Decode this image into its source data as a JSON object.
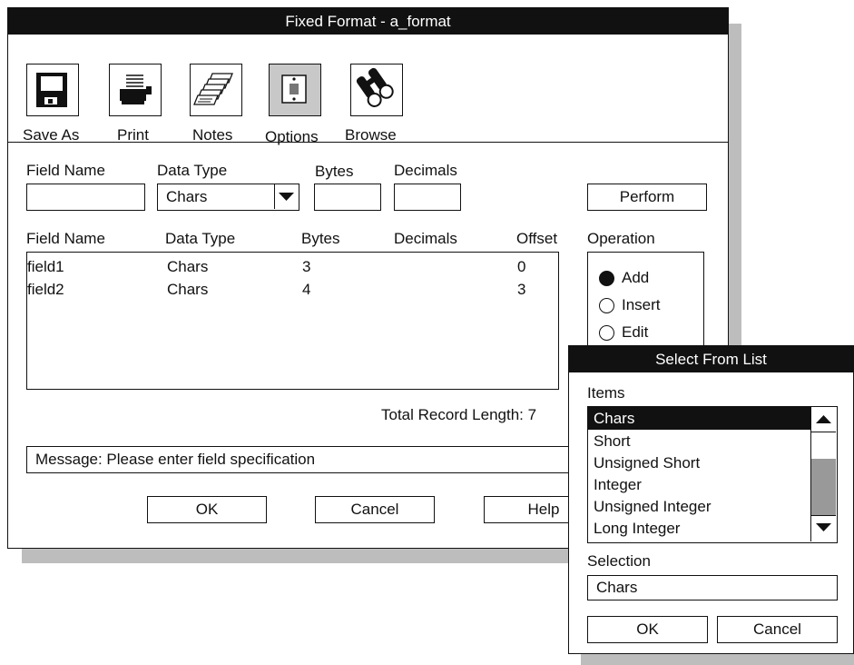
{
  "main_window": {
    "title": "Fixed Format - a_format",
    "toolbar": [
      {
        "label": "Save As",
        "icon": "floppy-disk-icon"
      },
      {
        "label": "Print",
        "icon": "printer-icon"
      },
      {
        "label": "Notes",
        "icon": "notes-stack-icon"
      },
      {
        "label": "Options",
        "icon": "options-panel-icon"
      },
      {
        "label": "Browse",
        "icon": "binoculars-icon"
      }
    ],
    "entry": {
      "field_name_label": "Field Name",
      "field_name_value": "",
      "data_type_label": "Data Type",
      "data_type_value": "Chars",
      "bytes_label": "Bytes",
      "bytes_value": "",
      "decimals_label": "Decimals",
      "decimals_value": "",
      "perform_label": "Perform"
    },
    "table": {
      "headers": [
        "Field Name",
        "Data Type",
        "Bytes",
        "Decimals",
        "Offset"
      ],
      "rows": [
        [
          "field1",
          "Chars",
          "3",
          "",
          "0"
        ],
        [
          "field2",
          "Chars",
          "4",
          "",
          "3"
        ]
      ]
    },
    "operation": {
      "label": "Operation",
      "options": [
        {
          "label": "Add",
          "selected": true
        },
        {
          "label": "Insert",
          "selected": false
        },
        {
          "label": "Edit",
          "selected": false
        }
      ]
    },
    "total_record_length": "Total Record Length: 7",
    "message": "Message: Please enter field specification",
    "buttons": {
      "ok": "OK",
      "cancel": "Cancel",
      "help": "Help"
    }
  },
  "select_dialog": {
    "title": "Select From List",
    "items_label": "Items",
    "items": [
      "Chars",
      "Short",
      "Unsigned Short",
      "Integer",
      "Unsigned Integer",
      "Long Integer"
    ],
    "selected_index": 0,
    "selection_label": "Selection",
    "selection_value": "Chars",
    "ok_label": "OK",
    "cancel_label": "Cancel"
  },
  "colors": {
    "titlebar": "#111111",
    "shadow": "#bdbdbd",
    "scroll_thumb": "#999999"
  }
}
